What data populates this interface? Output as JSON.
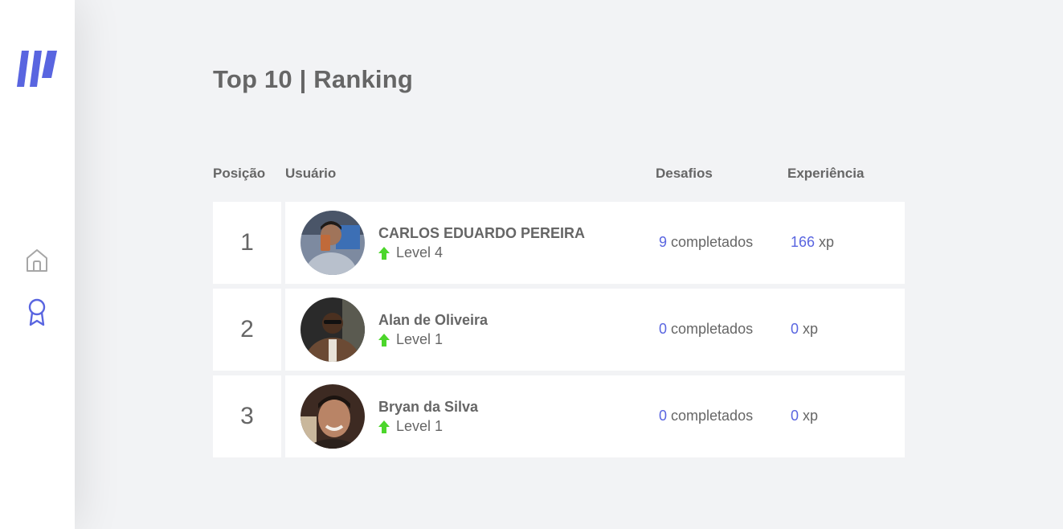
{
  "colors": {
    "accent": "#5965e0",
    "level_up": "#4cd62b",
    "text": "#666666",
    "background": "#f2f3f5",
    "card": "#ffffff"
  },
  "sidebar": {
    "logo": "moveit-logo",
    "items": [
      {
        "icon": "home-icon",
        "active": false
      },
      {
        "icon": "award-icon",
        "active": true
      }
    ]
  },
  "page": {
    "title": "Top 10 | Ranking"
  },
  "table": {
    "headers": {
      "position": "Posição",
      "user": "Usuário",
      "challenges": "Desafios",
      "experience": "Experiência"
    },
    "rows": [
      {
        "position": "1",
        "name": "CARLOS EDUARDO PEREIRA",
        "level": "Level 4",
        "challenges_count": "9",
        "challenges_suffix": " completados",
        "xp": "166",
        "xp_suffix": " xp"
      },
      {
        "position": "2",
        "name": "Alan de Oliveira",
        "level": "Level 1",
        "challenges_count": "0",
        "challenges_suffix": " completados",
        "xp": "0",
        "xp_suffix": " xp"
      },
      {
        "position": "3",
        "name": "Bryan da Silva",
        "level": "Level 1",
        "challenges_count": "0",
        "challenges_suffix": " completados",
        "xp": "0",
        "xp_suffix": " xp"
      }
    ]
  }
}
